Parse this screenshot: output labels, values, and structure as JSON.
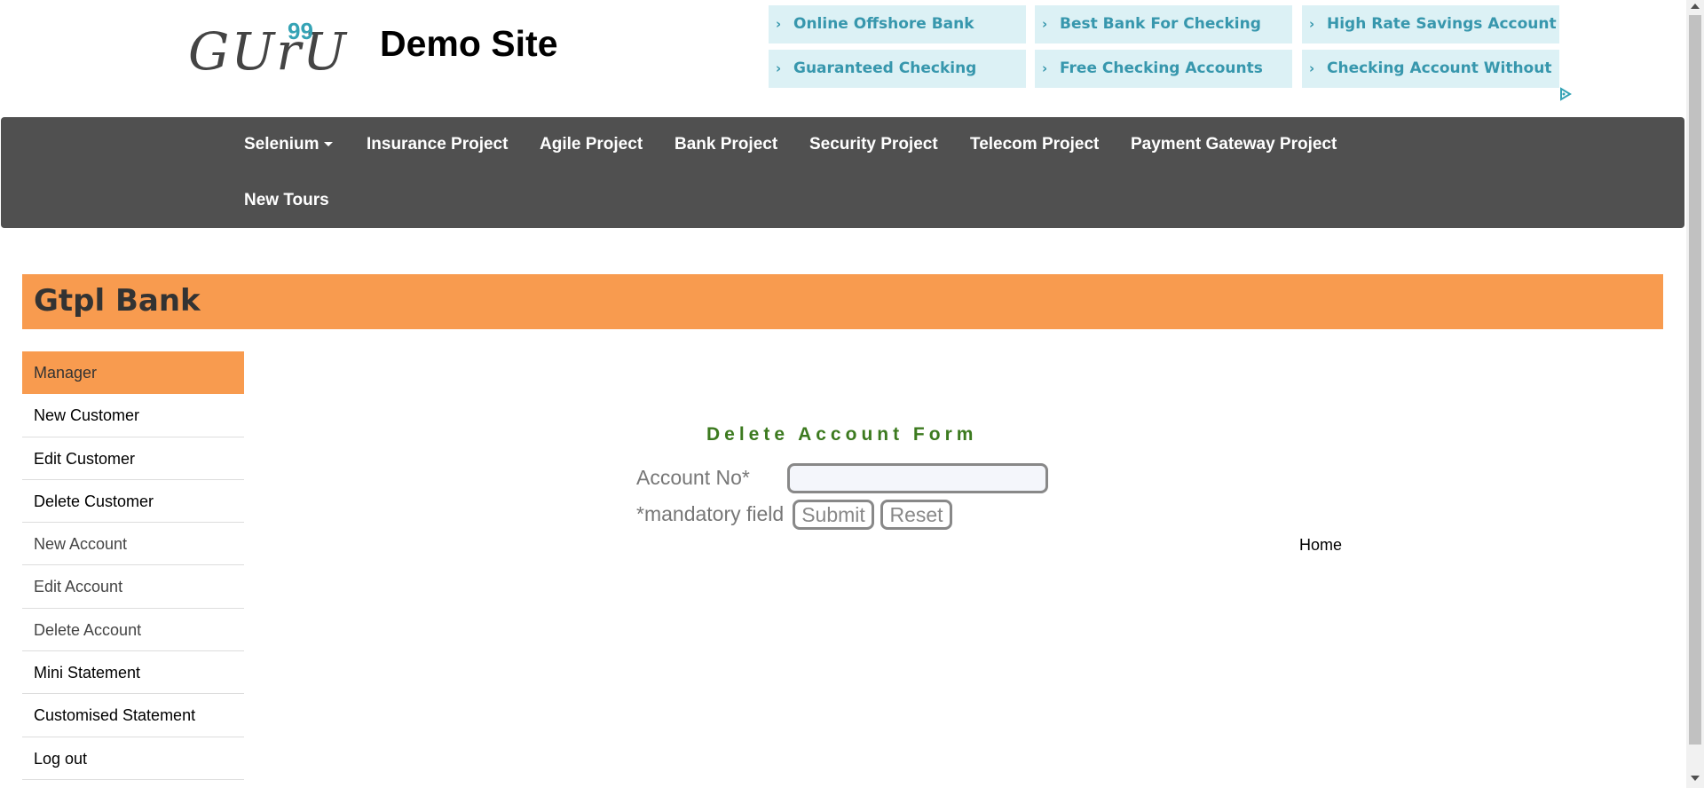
{
  "header": {
    "logo_text": "GUrU",
    "logo_superscript": "99",
    "site_title": "Demo Site"
  },
  "ads": [
    "Online Offshore Bank",
    "Best Bank For Checking",
    "High Rate Savings Account",
    "Guaranteed Checking",
    "Free Checking Accounts",
    "Checking Account Without"
  ],
  "ads_chevron": "›",
  "nav": {
    "items": [
      "Selenium",
      "Insurance Project",
      "Agile Project",
      "Bank Project",
      "Security Project",
      "Telecom Project",
      "Payment Gateway Project",
      "New Tours"
    ]
  },
  "bank": {
    "title": "Gtpl Bank"
  },
  "sidebar": {
    "items": [
      "Manager",
      "New Customer",
      "Edit Customer",
      "Delete Customer",
      "New Account",
      "Edit Account",
      "Delete Account",
      "Mini Statement",
      "Customised Statement",
      "Log out"
    ]
  },
  "form": {
    "title": "Delete Account Form",
    "account_label": "Account No*",
    "account_value": "",
    "mandatory_text": "*mandatory field",
    "submit_label": "Submit",
    "reset_label": "Reset",
    "home_link": "Home"
  },
  "colors": {
    "accent_orange": "#f89b4f",
    "nav_bg": "#505050",
    "ad_bg": "#dcf1f5",
    "ad_text": "#3797ad",
    "form_title": "#3c7a1f"
  }
}
